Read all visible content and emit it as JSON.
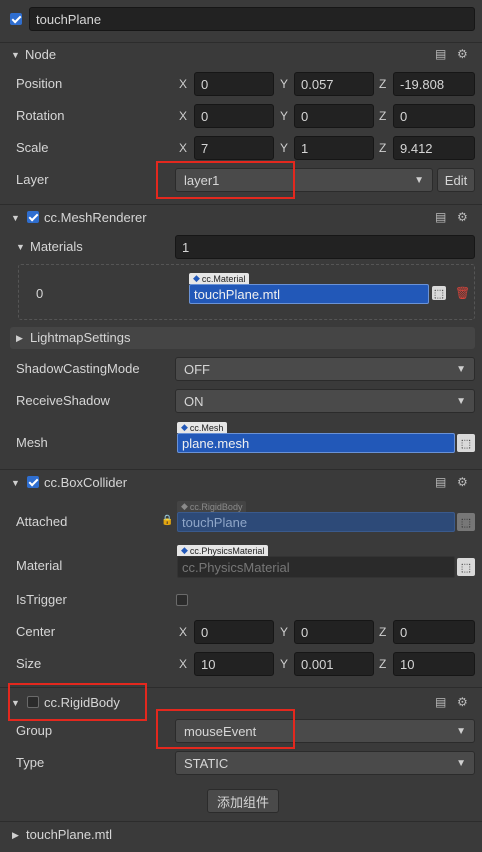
{
  "node": {
    "name": "touchPlane",
    "enabled": true
  },
  "node_section": {
    "title": "Node",
    "position": {
      "label": "Position",
      "x": "0",
      "y": "0.057",
      "z": "-19.808"
    },
    "rotation": {
      "label": "Rotation",
      "x": "0",
      "y": "0",
      "z": "0"
    },
    "scale": {
      "label": "Scale",
      "x": "7",
      "y": "1",
      "z": "9.412"
    },
    "layer": {
      "label": "Layer",
      "value": "layer1",
      "edit_label": "Edit"
    }
  },
  "axis_labels": {
    "x": "X",
    "y": "Y",
    "z": "Z"
  },
  "mesh_renderer": {
    "title": "cc.MeshRenderer",
    "enabled": true,
    "materials": {
      "label": "Materials",
      "count": "1",
      "index": "0",
      "tag": "cc.Material",
      "value": "touchPlane.mtl"
    },
    "lightmap": {
      "label": "LightmapSettings"
    },
    "shadow_casting": {
      "label": "ShadowCastingMode",
      "value": "OFF"
    },
    "receive_shadow": {
      "label": "ReceiveShadow",
      "value": "ON"
    },
    "mesh": {
      "label": "Mesh",
      "tag": "cc.Mesh",
      "value": "plane.mesh"
    }
  },
  "box_collider": {
    "title": "cc.BoxCollider",
    "enabled": true,
    "attached": {
      "label": "Attached",
      "tag": "cc.RigidBody",
      "value": "touchPlane"
    },
    "material": {
      "label": "Material",
      "tag": "cc.PhysicsMaterial",
      "placeholder": "cc.PhysicsMaterial"
    },
    "is_trigger": {
      "label": "IsTrigger",
      "checked": false
    },
    "center": {
      "label": "Center",
      "x": "0",
      "y": "0",
      "z": "0"
    },
    "size": {
      "label": "Size",
      "x": "10",
      "y": "0.001",
      "z": "10"
    }
  },
  "rigid_body": {
    "title": "cc.RigidBody",
    "enabled": false,
    "group": {
      "label": "Group",
      "value": "mouseEvent"
    },
    "type": {
      "label": "Type",
      "value": "STATIC"
    }
  },
  "add_component_label": "添加组件",
  "asset_section": {
    "title": "touchPlane.mtl"
  },
  "colors": {
    "background": "#3a3a3a",
    "field": "#222222",
    "accent": "#2f6ecf",
    "ref_blue": "#2258b8",
    "highlight": "#e3281e",
    "delete": "#d9443a"
  },
  "icons": [
    "checkbox-icon",
    "book-icon",
    "gear-icon",
    "triangle-down-icon",
    "triangle-right-icon",
    "lock-icon",
    "pick-icon",
    "trash-icon",
    "caret-down-icon"
  ]
}
